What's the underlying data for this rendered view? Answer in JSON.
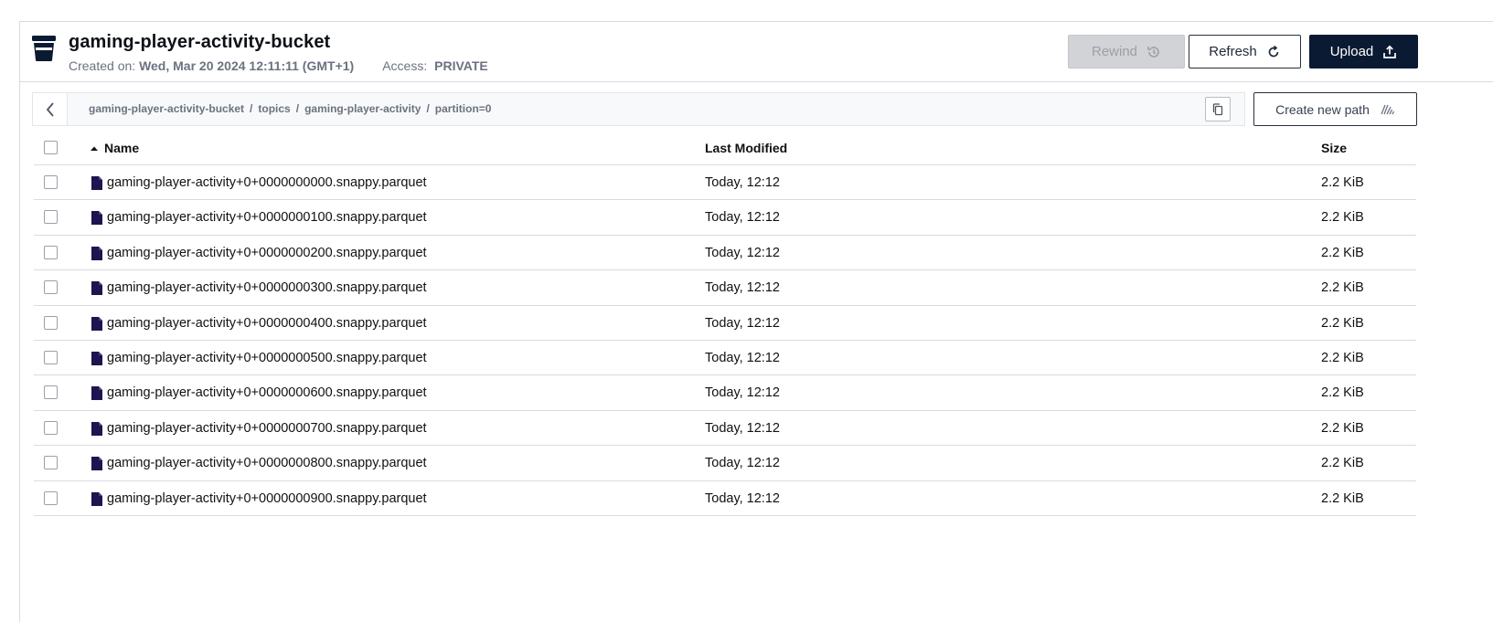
{
  "header": {
    "title": "gaming-player-activity-bucket",
    "created_label": "Created on:",
    "created_value": "Wed, Mar 20 2024 12:11:11 (GMT+1)",
    "access_label": "Access:",
    "access_value": "PRIVATE",
    "buttons": {
      "rewind": "Rewind",
      "refresh": "Refresh",
      "upload": "Upload"
    }
  },
  "pathbar": {
    "crumbs": [
      "gaming-player-activity-bucket",
      "topics",
      "gaming-player-activity",
      "partition=0"
    ],
    "separator": "/",
    "create_path_label": "Create new path"
  },
  "table": {
    "columns": {
      "name": "Name",
      "modified": "Last Modified",
      "size": "Size"
    },
    "rows": [
      {
        "name": "gaming-player-activity+0+0000000000.snappy.parquet",
        "modified": "Today, 12:12",
        "size": "2.2 KiB"
      },
      {
        "name": "gaming-player-activity+0+0000000100.snappy.parquet",
        "modified": "Today, 12:12",
        "size": "2.2 KiB"
      },
      {
        "name": "gaming-player-activity+0+0000000200.snappy.parquet",
        "modified": "Today, 12:12",
        "size": "2.2 KiB"
      },
      {
        "name": "gaming-player-activity+0+0000000300.snappy.parquet",
        "modified": "Today, 12:12",
        "size": "2.2 KiB"
      },
      {
        "name": "gaming-player-activity+0+0000000400.snappy.parquet",
        "modified": "Today, 12:12",
        "size": "2.2 KiB"
      },
      {
        "name": "gaming-player-activity+0+0000000500.snappy.parquet",
        "modified": "Today, 12:12",
        "size": "2.2 KiB"
      },
      {
        "name": "gaming-player-activity+0+0000000600.snappy.parquet",
        "modified": "Today, 12:12",
        "size": "2.2 KiB"
      },
      {
        "name": "gaming-player-activity+0+0000000700.snappy.parquet",
        "modified": "Today, 12:12",
        "size": "2.2 KiB"
      },
      {
        "name": "gaming-player-activity+0+0000000800.snappy.parquet",
        "modified": "Today, 12:12",
        "size": "2.2 KiB"
      },
      {
        "name": "gaming-player-activity+0+0000000900.snappy.parquet",
        "modified": "Today, 12:12",
        "size": "2.2 KiB"
      }
    ]
  },
  "icons": {
    "bucket": "bucket-icon",
    "rewind": "rewind-icon",
    "refresh": "refresh-icon",
    "upload": "upload-icon",
    "back": "chevron-left-icon",
    "copy": "copy-icon",
    "new_path": "new-path-icon",
    "sort": "sort-ascending-icon",
    "file": "file-icon"
  },
  "colors": {
    "primary": "#0b1a33",
    "file_icon": "#1e1450",
    "disabled_bg": "#d1d3d6"
  }
}
